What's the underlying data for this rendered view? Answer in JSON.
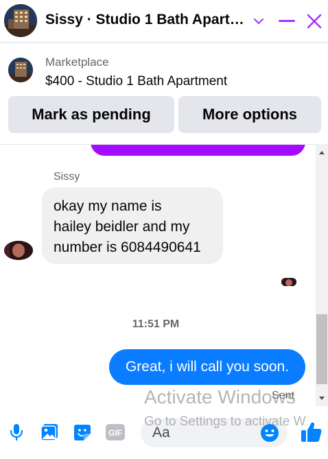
{
  "header": {
    "title": "Sissy · Studio 1 Bath Apartment",
    "avatar_icon": "building-photo",
    "chevron_icon": "chevron-down-icon",
    "minimize_icon": "minimize-icon",
    "close_icon": "close-icon",
    "accent_color": "#a033ff"
  },
  "marketplace": {
    "label": "Marketplace",
    "item": "$400 - Studio 1 Bath Apartment",
    "buttons": {
      "pending": "Mark as pending",
      "more": "More options"
    }
  },
  "conversation": {
    "sender_name": "Sissy",
    "incoming_lines": [
      "okay my name is",
      "hailey beidler and my",
      "number is 6084490641"
    ],
    "timestamp": "11:51 PM",
    "outgoing_message": "Great, i will call you soon.",
    "sent_status": "Sent",
    "colors": {
      "incoming_bubble": "#f0f0f0",
      "outgoing_bubble": "#0a7cff",
      "previous_bubble": "#a40bff"
    }
  },
  "watermark": {
    "title": "Activate Windows",
    "subtitle": "Go to Settings to activate W"
  },
  "composer": {
    "placeholder": "Aa",
    "icons": [
      "microphone-icon",
      "photo-icon",
      "sticker-icon",
      "gif-icon",
      "emoji-icon",
      "thumbs-up-icon"
    ],
    "gif_label": "GIF",
    "icon_color": "#0084ff"
  }
}
